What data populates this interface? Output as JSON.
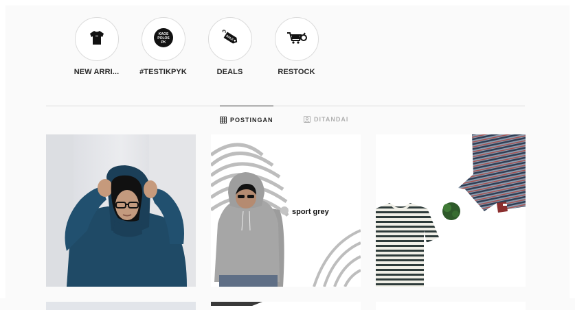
{
  "highlights": [
    {
      "label": "NEW ARRI...",
      "icon": "tshirt-icon"
    },
    {
      "label": "#TESTIKPYK",
      "icon": "kaos-polos-logo-icon",
      "icon_text": [
        "KAOS",
        "POLOS",
        "PK"
      ]
    },
    {
      "label": "DEALS",
      "icon": "sale-tag-icon",
      "icon_text": "SALE"
    },
    {
      "label": "RESTOCK",
      "icon": "cart-icon"
    }
  ],
  "tabs": [
    {
      "label": "POSTINGAN",
      "icon": "grid-icon",
      "active": true
    },
    {
      "label": "DITANDAI",
      "icon": "tagged-icon",
      "active": false
    }
  ],
  "posts": [
    {
      "kind": "photo",
      "subject": "woman-navy-hoodie"
    },
    {
      "kind": "product",
      "subject": "grey-hoodie",
      "caption": "sport grey",
      "swatch_color": "#c4c4c4"
    },
    {
      "kind": "product",
      "subject": "striped-tshirts"
    }
  ],
  "colors": {
    "accent": "#262626",
    "muted": "#b0b0b0",
    "border": "#dbdbdb"
  }
}
